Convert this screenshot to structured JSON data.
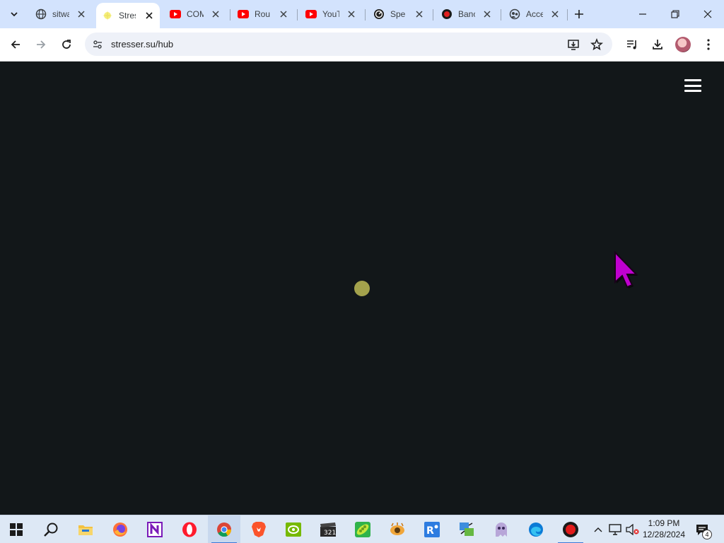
{
  "browser": {
    "tabs": [
      {
        "title": "sitwa",
        "favicon": "globe-icon",
        "active": false
      },
      {
        "title": "Stres",
        "favicon": "sparkle-icon",
        "active": true
      },
      {
        "title": "COM",
        "favicon": "youtube-icon",
        "active": false
      },
      {
        "title": "Rou",
        "favicon": "youtube-icon",
        "active": false
      },
      {
        "title": "YouT",
        "favicon": "youtube-icon",
        "active": false
      },
      {
        "title": "Spe",
        "favicon": "speedtest-icon",
        "active": false
      },
      {
        "title": "Banc",
        "favicon": "record-icon",
        "active": false
      },
      {
        "title": "Acce",
        "favicon": "gear-people-icon",
        "active": false
      }
    ],
    "address_bar": {
      "url": "stresser.su/hub"
    },
    "colors": {
      "tabstrip": "#d3e3fd",
      "page_background": "#121719",
      "loader": "#a3a24c",
      "cursor": "#c000d0",
      "youtube_red": "#ff0000"
    }
  },
  "page": {
    "menu_icon": "hamburger-menu-icon",
    "loading_indicator": "loading-dot"
  },
  "taskbar": {
    "apps": [
      "windows-start-icon",
      "search-icon",
      "file-explorer-icon",
      "firefox-icon",
      "onenote-icon",
      "opera-icon",
      "chrome-icon",
      "brave-icon",
      "nvidia-icon",
      "clapper-icon",
      "pea-icon",
      "eye-icon",
      "rq-icon",
      "network-tool-icon",
      "ghost-icon",
      "edge-icon",
      "record-icon"
    ],
    "clock_time": "1:09 PM",
    "clock_date": "12/28/2024",
    "notification_count": "4"
  }
}
